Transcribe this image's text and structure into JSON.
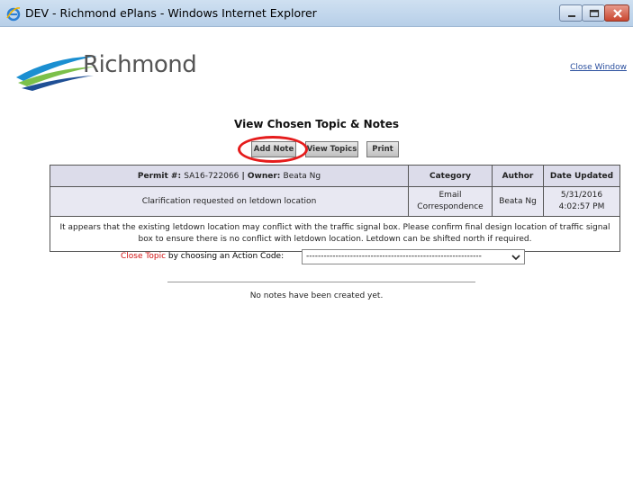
{
  "window": {
    "title": "DEV - Richmond ePlans - Windows Internet Explorer"
  },
  "header": {
    "logo_text": "Richmond",
    "close_window_link": "Close Window"
  },
  "page": {
    "heading": "View Chosen Topic & Notes",
    "buttons": {
      "add_note": "Add Note",
      "view_topics": "View Topics",
      "print": "Print"
    },
    "table": {
      "permit_label": "Permit #:",
      "permit_value": "SA16-722066",
      "separator": "|",
      "owner_label": "Owner:",
      "owner_value": "Beata Ng",
      "headers": {
        "category": "Category",
        "author": "Author",
        "date_updated": "Date Updated"
      },
      "row": {
        "topic": "Clarification requested on letdown location",
        "category": "Email Correspondence",
        "author": "Beata Ng",
        "date": "5/31/2016",
        "time": "4:02:57 PM"
      },
      "description": "It appears that the existing letdown location may conflict with the traffic signal box. Please confirm final design location of traffic signal box to ensure there is no conflict with letdown location. Letdown can be shifted north if required."
    },
    "action": {
      "close_topic": "Close Topic",
      "label_rest": "by choosing an Action Code:",
      "select_value": "------------------------------------------------------------"
    },
    "notes_status": "No notes have been created yet."
  },
  "colors": {
    "highlight": "#e51c1c",
    "close_topic_text": "#d01010",
    "link": "#2a4f9e"
  }
}
